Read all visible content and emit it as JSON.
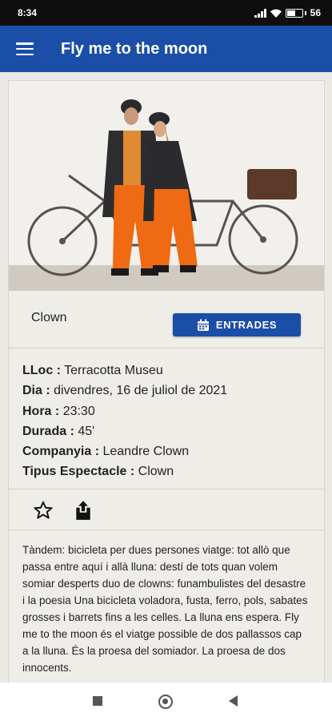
{
  "status_bar": {
    "time": "8:34",
    "battery": "56"
  },
  "app_bar": {
    "title": "Fly me to the moon"
  },
  "event": {
    "genre": "Clown",
    "tickets_button": "ENTRADES",
    "details": [
      {
        "label": "LLoc :",
        "value": "Terracotta Museu"
      },
      {
        "label": "Dia :",
        "value": "divendres, 16 de juliol de 2021"
      },
      {
        "label": "Hora :",
        "value": "23:30"
      },
      {
        "label": "Durada :",
        "value": "45'"
      },
      {
        "label": "Companyia :",
        "value": "Leandre Clown"
      },
      {
        "label": "Tipus Espectacle :",
        "value": "Clown"
      }
    ],
    "description": "Tàndem: bicicleta per dues persones viatge: tot allò que passa entre aquí i allà lluna: destí de tots quan volem somiar desperts duo de clowns: funambulistes del desastre i la poesia Una bicicleta voladora, fusta, ferro, pols, sabates grosses i barrets fins a les celles. La lluna ens espera. Fly me to the moon és el viatge possible de dos pallassos cap a la lluna. És la proesa del somiador. La proesa de dos innocents."
  },
  "colors": {
    "primary": "#1b4ea7",
    "background": "#ebe9e4"
  },
  "icons": [
    "menu-icon",
    "calendar-icon",
    "star-icon",
    "share-icon"
  ]
}
